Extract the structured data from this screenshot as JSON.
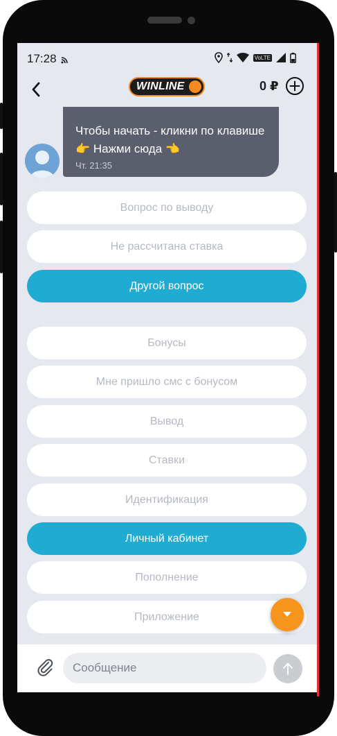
{
  "status_bar": {
    "time": "17:28",
    "icons": [
      "cast-icon",
      "location-icon",
      "data-arrows-icon",
      "wifi-icon",
      "volte-icon",
      "signal-icon",
      "battery-icon"
    ],
    "volte_label": "VoLTE"
  },
  "header": {
    "logo_text": "WINLINE",
    "balance": "0 ₽",
    "icons": [
      "back-arrow-icon",
      "add-circle-icon"
    ]
  },
  "chat": {
    "message": {
      "text": "Чтобы начать - кликни по клавише 👉 Нажми сюда 👈",
      "time": "Чт. 21:35"
    },
    "options": [
      {
        "label": "Вопрос по выводу",
        "selected": false
      },
      {
        "label": "Не рассчитана ставка",
        "selected": false
      },
      {
        "label": "Другой вопрос",
        "selected": true
      },
      {
        "label": "Бонусы",
        "selected": false
      },
      {
        "label": "Мне пришло смс с бонусом",
        "selected": false
      },
      {
        "label": "Вывод",
        "selected": false
      },
      {
        "label": "Ставки",
        "selected": false
      },
      {
        "label": "Идентификация",
        "selected": false
      },
      {
        "label": "Личный кабинет",
        "selected": true
      },
      {
        "label": "Пополнение",
        "selected": false
      },
      {
        "label": "Приложение",
        "selected": false
      }
    ]
  },
  "composer": {
    "placeholder": "Сообщение",
    "icons": [
      "paperclip-icon",
      "send-arrow-icon"
    ]
  },
  "colors": {
    "accent_blue": "#20acd2",
    "brand_orange": "#f7941d",
    "chat_background": "#e5e9ef",
    "bubble": "#5b5f6d"
  }
}
